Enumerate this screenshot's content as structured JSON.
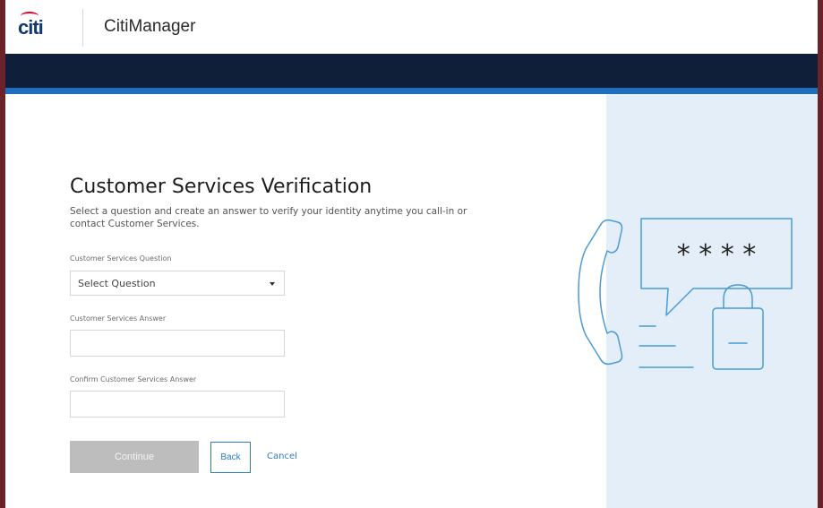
{
  "header": {
    "logo_text": "citi",
    "app_title": "CitiManager"
  },
  "main": {
    "title": "Customer Services Verification",
    "subtitle": "Select a question and create an answer to verify your identity anytime you call-in or contact Customer Services."
  },
  "form": {
    "question_label": "Customer Services Question",
    "question_selected": "Select Question",
    "answer_label": "Customer Services Answer",
    "answer_value": "",
    "confirm_label": "Confirm Customer Services Answer",
    "confirm_value": ""
  },
  "actions": {
    "continue_label": "Continue",
    "back_label": "Back",
    "cancel_label": "Cancel"
  },
  "illustration": {
    "masked_text": "* * * *"
  },
  "colors": {
    "nav": "#0f1f3a",
    "accent": "#1d6ec0",
    "panel": "#e4eef8",
    "link": "#2e7bc4",
    "disabled": "#bdbdbd"
  }
}
